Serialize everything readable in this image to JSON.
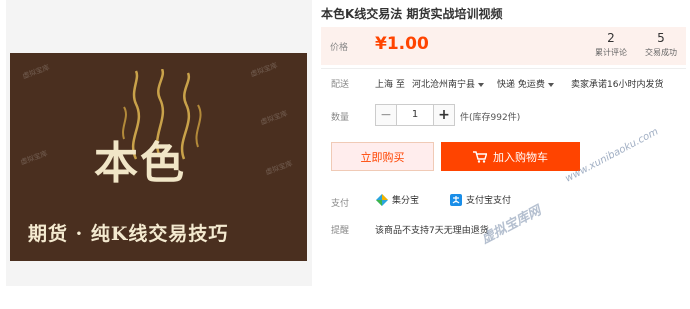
{
  "product_image": {
    "title_text": "本色",
    "subtitle_text": "期货 · 纯K线交易技巧",
    "watermark": "虚拟宝库"
  },
  "product": {
    "title": "本色K线交易法 期货实战培训视频"
  },
  "price": {
    "label": "价格",
    "value": "¥1.00",
    "color": "#ff4400"
  },
  "stats": [
    {
      "num": "2",
      "caption": "累计评论"
    },
    {
      "num": "5",
      "caption": "交易成功"
    }
  ],
  "shipping": {
    "label": "配送",
    "from": "上海 至",
    "to": "河北沧州南宁县",
    "method": "快递 免运费",
    "promise": "卖家承诺16小时内发货"
  },
  "quantity": {
    "label": "数量",
    "value": "1",
    "minus": "−",
    "plus": "+",
    "stock": "件(库存992件)"
  },
  "buttons": {
    "buy_now": "立即购买",
    "add_to_cart": "加入购物车"
  },
  "payment": {
    "label": "支付",
    "methods": [
      {
        "name": "集分宝",
        "icon": "jifenbao-icon"
      },
      {
        "name": "支付宝支付",
        "icon": "alipay-icon"
      }
    ]
  },
  "tips": {
    "label": "提醒",
    "text": "该商品不支持7天无理由退货"
  },
  "watermarks": {
    "url": "www.xunibaoku.com",
    "name": "虚拟宝库网"
  }
}
